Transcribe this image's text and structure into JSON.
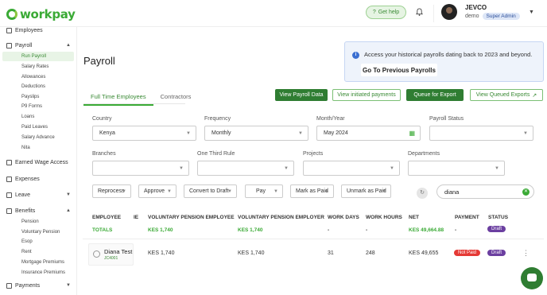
{
  "brand": {
    "name": "workpay",
    "accent": "#3aaa35",
    "dark_green": "#2f7d32"
  },
  "header": {
    "help_label": "Get help",
    "company": "JEVCO",
    "user_name": "demo",
    "role": "Super Admin"
  },
  "sidebar": {
    "items": [
      {
        "label": "Employees",
        "icon": "people-icon",
        "caret": ""
      },
      {
        "label": "Payroll",
        "icon": "wallet-icon",
        "caret": "▲"
      },
      {
        "label": "Earned Wage Access",
        "icon": "gear-icon",
        "caret": ""
      },
      {
        "label": "Expenses",
        "icon": "receipt-icon",
        "caret": ""
      },
      {
        "label": "Leave",
        "icon": "swap-icon",
        "caret": "▼"
      },
      {
        "label": "Benefits",
        "icon": "currency-icon",
        "caret": "▲"
      },
      {
        "label": "Payments",
        "icon": "card-icon",
        "caret": "▼"
      }
    ],
    "payroll_sub": [
      "Run Payroll",
      "Salary Rates",
      "Allowances",
      "Deductions",
      "Payslips",
      "P9 Forms",
      "Loans",
      "Paid Leaves",
      "Salary Advance",
      "Nita"
    ],
    "benefits_sub": [
      "Pension",
      "Voluntary Pension",
      "Esop",
      "Rent",
      "Mortgage Premiums",
      "Insurance Premiums"
    ]
  },
  "page": {
    "title": "Payroll"
  },
  "notice": {
    "text": "Access your historical payrolls dating back to 2023 and beyond.",
    "button": "Go To Previous Payrolls"
  },
  "tabs": [
    "Full Time Employees",
    "Contractors"
  ],
  "actions": {
    "view_data": "View Payroll Data",
    "view_initiated": "View initiated payments",
    "queue": "Queue for Export",
    "view_queued": "View Queued Exports"
  },
  "filters": {
    "country": {
      "label": "Country",
      "value": "Kenya"
    },
    "frequency": {
      "label": "Frequency",
      "value": "Monthly"
    },
    "month": {
      "label": "Month/Year",
      "value": "May 2024"
    },
    "status": {
      "label": "Payroll Status",
      "value": ""
    },
    "branches": {
      "label": "Branches",
      "value": ""
    },
    "third": {
      "label": "One Third Rule",
      "value": ""
    },
    "projects": {
      "label": "Projects",
      "value": ""
    },
    "departments": {
      "label": "Departments",
      "value": ""
    }
  },
  "bulk": [
    "Reprocess",
    "Approve",
    "Convert to Draft",
    "Pay",
    "Mark as Paid",
    "Unmark as Paid"
  ],
  "search": {
    "value": "diana"
  },
  "table": {
    "headers": [
      "EMPLOYEE",
      "IE",
      "VOLUNTARY PENSION EMPLOYEE",
      "VOLUNTARY PENSION EMPLOYER",
      "WORK DAYS",
      "WORK HOURS",
      "NET",
      "PAYMENT",
      "STATUS"
    ],
    "totals": {
      "label": "TOTALS",
      "vpe": "KES 1,740",
      "vpr": "KES 1,740",
      "days": "-",
      "hours": "-",
      "net": "KES 49,664.88",
      "payment": "-",
      "status": "Draft"
    },
    "rows": [
      {
        "name": "Diana Test",
        "id": "JC4001",
        "vpe": "KES 1,740",
        "vpr": "KES 1,740",
        "days": "31",
        "hours": "248",
        "net": "KES 49,655",
        "payment": "Not Paid",
        "status": "Draft"
      }
    ]
  }
}
